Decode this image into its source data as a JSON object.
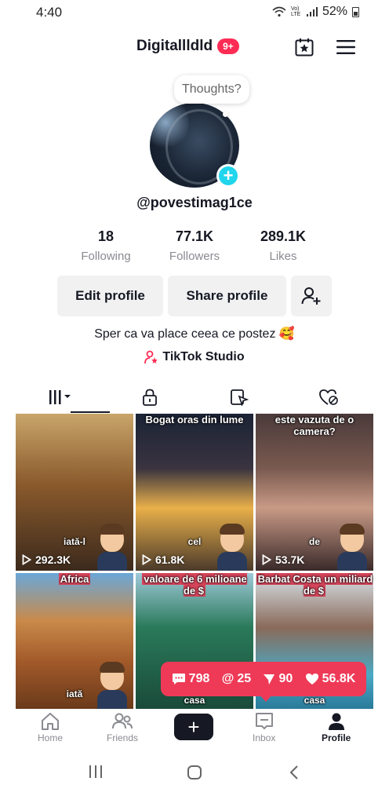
{
  "status_bar": {
    "time": "4:40",
    "battery": "52%",
    "signal_text": "Vo) LTE"
  },
  "header": {
    "username": "Digitallldld",
    "notif_count": "9+",
    "icons": [
      "calendar-star-icon",
      "menu-icon"
    ]
  },
  "profile": {
    "thought_bubble": "Thoughts?",
    "handle": "@povestimag1ce",
    "stats": [
      {
        "value": "18",
        "label": "Following"
      },
      {
        "value": "77.1K",
        "label": "Followers"
      },
      {
        "value": "289.1K",
        "label": "Likes"
      }
    ],
    "edit_button": "Edit profile",
    "share_button": "Share profile",
    "bio": "Sper ca va place ceea ce postez 🥰",
    "studio_link": "TikTok Studio"
  },
  "tabs": [
    "videos-grid-icon",
    "lock-icon",
    "repost-icon",
    "liked-heart-icon"
  ],
  "videos": [
    {
      "top_caption": "",
      "mid_caption": "iată-l",
      "views": "292.3K"
    },
    {
      "top_caption": "Bogat oras din lume",
      "mid_caption": "cel",
      "views": "61.8K"
    },
    {
      "top_caption": "este vazuta de o camera?",
      "mid_caption": "de",
      "views": "53.7K"
    },
    {
      "top_caption": "Africa",
      "mid_caption": "iată",
      "views": ""
    },
    {
      "top_caption": "valoare de 6 milioane de $",
      "mid_caption": "casa",
      "views": ""
    },
    {
      "top_caption": "Barbat Costa un miliard de $",
      "mid_caption": "casa",
      "views": ""
    }
  ],
  "engagement": {
    "comments": "798",
    "mentions": "25",
    "shares": "90",
    "likes": "56.8K"
  },
  "bottom_nav": {
    "home": "Home",
    "friends": "Friends",
    "inbox": "Inbox",
    "profile": "Profile",
    "create": "+"
  },
  "colors": {
    "accent_red": "#fe2c55",
    "accent_cyan": "#20d5ec",
    "engagement_bg": "#ee3a57"
  }
}
